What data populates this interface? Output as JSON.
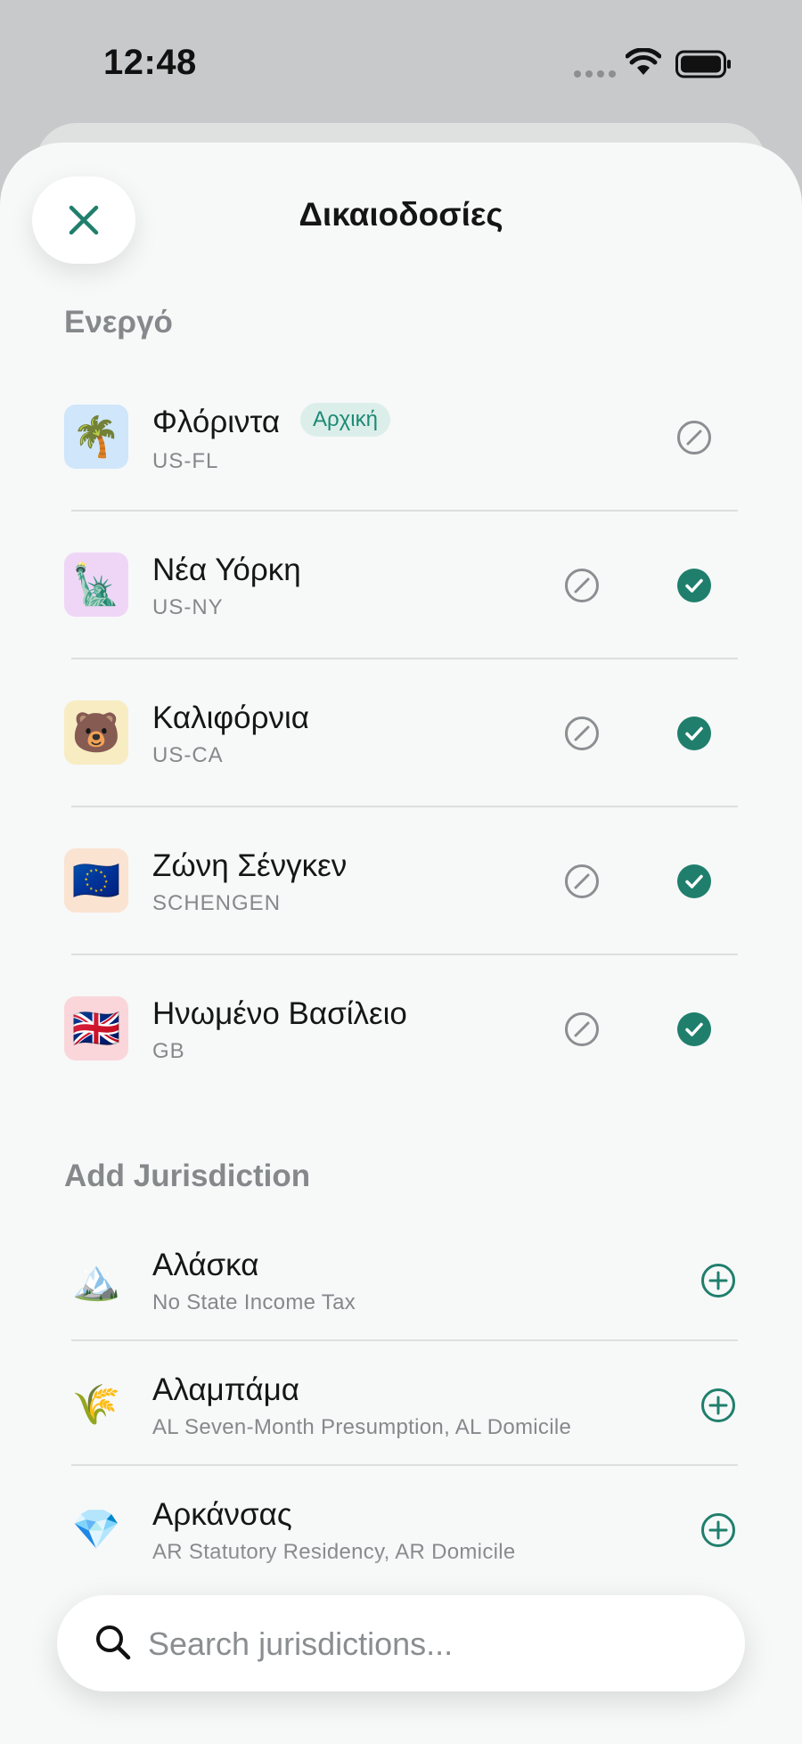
{
  "status_bar": {
    "time": "12:48",
    "wifi_icon": "wifi-icon",
    "battery_icon": "battery-icon",
    "signal_icon": "signal-dots-icon"
  },
  "header": {
    "title": "Δικαιοδοσίες",
    "close_icon": "close-icon"
  },
  "colors": {
    "accent": "#1f7f6c",
    "badge_bg": "#dceeea",
    "muted_text": "#85898b"
  },
  "active_section": {
    "title": "Ενεργό",
    "items": [
      {
        "name": "Φλόριντα",
        "code": "US-FL",
        "emoji": "🌴",
        "icon_bg": "#cfe6fb",
        "badge": "Αρχική",
        "checked": false
      },
      {
        "name": "Νέα Υόρκη",
        "code": "US-NY",
        "emoji": "🗽",
        "icon_bg": "#efd6f6",
        "badge": "",
        "checked": true
      },
      {
        "name": "Καλιφόρνια",
        "code": "US-CA",
        "emoji": "🐻",
        "icon_bg": "#f8ecc3",
        "badge": "",
        "checked": true
      },
      {
        "name": "Ζώνη Σένγκεν",
        "code": "SCHENGEN",
        "emoji": "🇪🇺",
        "icon_bg": "#fbe3d2",
        "badge": "",
        "checked": true
      },
      {
        "name": "Ηνωμένο Βασίλειο",
        "code": "GB",
        "emoji": "🇬🇧",
        "icon_bg": "#fad6da",
        "badge": "",
        "checked": true
      }
    ]
  },
  "add_section": {
    "title": "Add Jurisdiction",
    "items": [
      {
        "name": "Αλάσκα",
        "description": "No State Income Tax",
        "emoji": "🏔️"
      },
      {
        "name": "Αλαμπάμα",
        "description": "AL Seven-Month Presumption, AL Domicile",
        "emoji": "🌾"
      },
      {
        "name": "Αρκάνσας",
        "description": "AR Statutory Residency, AR Domicile",
        "emoji": "💎"
      }
    ]
  },
  "search": {
    "placeholder": "Search jurisdictions...",
    "value": ""
  }
}
